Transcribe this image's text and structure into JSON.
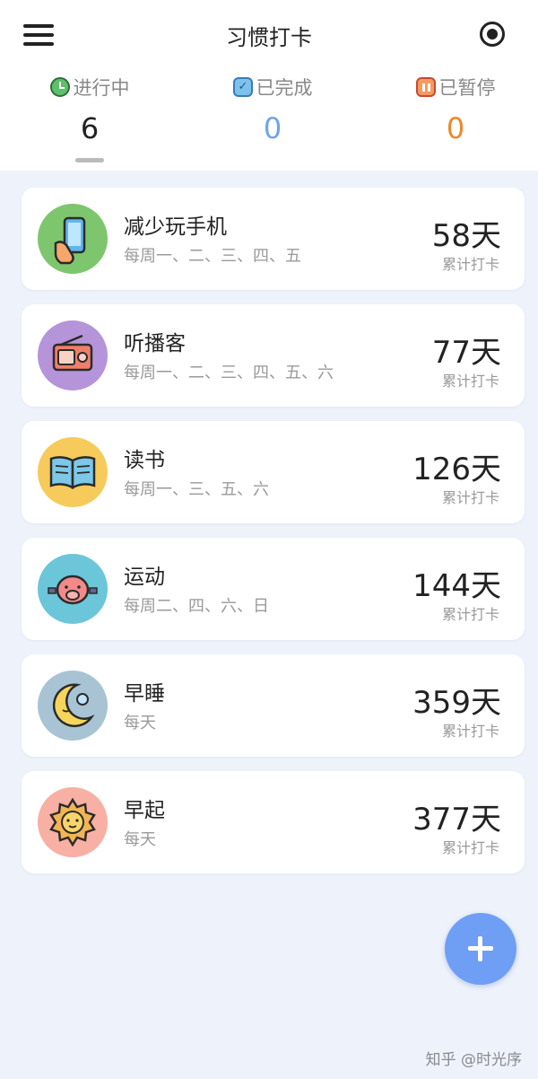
{
  "header": {
    "title": "习惯打卡"
  },
  "tabs": [
    {
      "label": "进行中",
      "count": "6",
      "icon": "clock-icon",
      "color": "#222222"
    },
    {
      "label": "已完成",
      "count": "0",
      "icon": "calendar-check-icon",
      "color": "#6fa4ea"
    },
    {
      "label": "已暂停",
      "count": "0",
      "icon": "pause-icon",
      "color": "#ea8a2c"
    }
  ],
  "habits": [
    {
      "name": "减少玩手机",
      "schedule": "每周一、二、三、四、五",
      "days": "58天",
      "sub": "累计打卡",
      "icon": "phone-hand-icon",
      "bg": "#7dc66e"
    },
    {
      "name": "听播客",
      "schedule": "每周一、二、三、四、五、六",
      "days": "77天",
      "sub": "累计打卡",
      "icon": "radio-icon",
      "bg": "#b694d9"
    },
    {
      "name": "读书",
      "schedule": "每周一、三、五、六",
      "days": "126天",
      "sub": "累计打卡",
      "icon": "book-icon",
      "bg": "#f6cb5b"
    },
    {
      "name": "运动",
      "schedule": "每周二、四、六、日",
      "days": "144天",
      "sub": "累计打卡",
      "icon": "pig-icon",
      "bg": "#6bc6d9"
    },
    {
      "name": "早睡",
      "schedule": "每天",
      "days": "359天",
      "sub": "累计打卡",
      "icon": "moon-icon",
      "bg": "#a8c3d4"
    },
    {
      "name": "早起",
      "schedule": "每天",
      "days": "377天",
      "sub": "累计打卡",
      "icon": "sun-icon",
      "bg": "#f7b0a3"
    }
  ],
  "fab": {
    "icon": "plus-icon"
  },
  "watermark": "知乎 @时光序"
}
